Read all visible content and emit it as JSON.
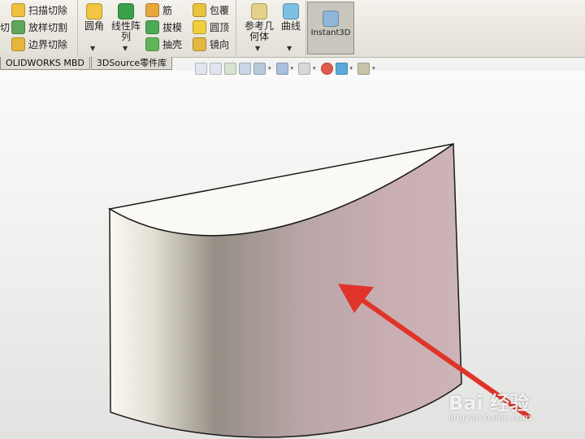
{
  "ribbon": {
    "group1": {
      "cut_partial": "切",
      "items": [
        {
          "icon": "sweep-cut-icon",
          "label": "扫描切除"
        },
        {
          "icon": "loft-cut-icon",
          "label": "放样切割"
        },
        {
          "icon": "boundary-cut-icon",
          "label": "边界切除"
        }
      ]
    },
    "group2": {
      "fillet": {
        "icon": "fillet-icon",
        "label": "圆角"
      },
      "linear_pattern": {
        "icon": "linear-pattern-icon",
        "line1": "线性阵",
        "line2": "列"
      },
      "col1": [
        {
          "icon": "rib-icon",
          "label": "筋"
        },
        {
          "icon": "draft-icon",
          "label": "拔模"
        },
        {
          "icon": "shell-icon",
          "label": "抽壳"
        }
      ],
      "col2": [
        {
          "icon": "wrap-icon",
          "label": "包覆"
        },
        {
          "icon": "dome-icon",
          "label": "圆顶"
        },
        {
          "icon": "mirror-icon",
          "label": "镜向"
        }
      ]
    },
    "group3": {
      "ref_geometry": {
        "icon": "reference-geometry-icon",
        "line1": "参考几",
        "line2": "何体"
      },
      "curves": {
        "icon": "curves-icon",
        "label": "曲线"
      }
    },
    "instant3d": {
      "icon": "instant3d-icon",
      "label": "Instant3D"
    },
    "dropdown_glyph": "▼"
  },
  "tabs": [
    "OLIDWORKS MBD",
    "3DSource零件库"
  ],
  "hud_icons": [
    "zoom-to-fit-icon",
    "zoom-area-icon",
    "previous-view-icon",
    "section-view-icon",
    "view-orientation-icon",
    "display-style-icon",
    "hide-show-icon",
    "edit-appearance-icon",
    "scene-icon",
    "view-settings-icon"
  ],
  "hud_dropdown": "▾",
  "colors": {
    "arrow": "#e0342b",
    "edge": "#1a1a1a",
    "face_light": "#f4f1ea",
    "face_dark": "#8f8b83",
    "face_pink": "#c8aeb3"
  },
  "watermark": {
    "brand": "Bai 经验",
    "url": "jingyan.baidu.com"
  }
}
